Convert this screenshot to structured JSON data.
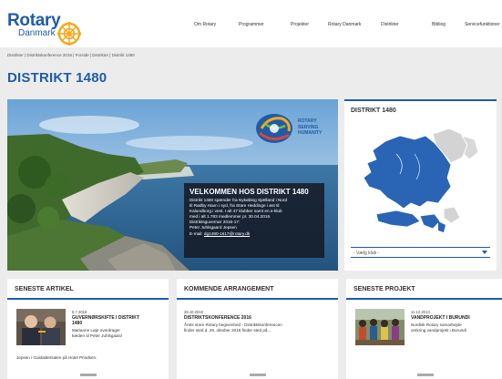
{
  "header": {
    "logo_main": "Rotary",
    "logo_sub": "Danmark",
    "nav": [
      "Om Rotary",
      "Programmer",
      "Projekter",
      "Rotary Danmark",
      "Distrikter",
      "Bibliog",
      "Servicefunktioner"
    ]
  },
  "breadcrumb": "Distrikter | Distriktskonference 2016 | Forside | Distrikter | Distrikt 1480",
  "page_title": "DISTRIKT 1480",
  "hero": {
    "rsh_line1": "ROTARY",
    "rsh_line2": "SERVING",
    "rsh_line3": "HUMANITY",
    "box_title": "VELKOMMEN HOS DISTRIKT 1480",
    "box_lines": [
      "Distrikt 1480 spænder fra Nykøbing Sjælland i Nord",
      "til Rødby Havn i syd, fra Stare Heddinge i øst til",
      "Kalundborg i vest. I alt 47 klubber samt en e-klub",
      "med i alt 1.783 medlemmer pr. 30.04.2016.",
      "Distriktsguvernør 2016-17:",
      "Peter Juhlsgaard Jepsen"
    ],
    "email_prefix": "E-mail:",
    "email": "dg1480-1617@rotary.dk"
  },
  "map_card": {
    "title": "DISTRIKT 1480",
    "select_label": "- Vælg klub -"
  },
  "cards": [
    {
      "title": "SENESTE ARTIKEL",
      "date": "6.7.2016",
      "headline_lines": [
        "GUVERNØRSKIFTE I DISTRIKT",
        "1480"
      ],
      "body_lines": [
        "Marianne Løje overdrager",
        "kæden til Peter Juhlsgaard",
        "Jepsen i Guldaldersalen på Hotel Prindsen."
      ]
    },
    {
      "title": "KOMMENDE ARRANGEMENT",
      "date": "28.10.2016",
      "headline_lines": [
        "DISTRIKTSKONFERENCE 2016"
      ],
      "body_lines": [
        "Årets store Rotary begivenhed - Distriktskonferencen",
        "finder sted d. 29. oktober 2016 finder sted på..."
      ]
    },
    {
      "title": "SENESTE PROJEKT",
      "date": "11.12.2013",
      "headline_lines": [
        "VANDPROJEKT I BURUNDI"
      ],
      "body_lines": [
        "Nordisk Rotary samarbejde",
        "omkring vandprojekt i Burundi"
      ]
    }
  ],
  "colors": {
    "brand_blue": "#1f5ca5",
    "gold": "#f7a81b"
  }
}
